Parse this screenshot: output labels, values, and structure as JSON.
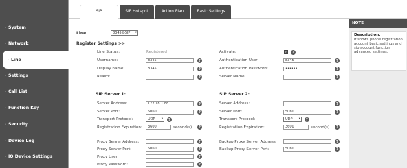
{
  "sidebar": {
    "items": [
      {
        "label": "System",
        "active": false
      },
      {
        "label": "Network",
        "active": false
      },
      {
        "label": "Line",
        "active": true
      },
      {
        "label": "Settings",
        "active": false
      },
      {
        "label": "Call List",
        "active": false
      },
      {
        "label": "Function Key",
        "active": false
      },
      {
        "label": "Security",
        "active": false
      },
      {
        "label": "Device Log",
        "active": false
      },
      {
        "label": "IO Device Settings",
        "active": false
      }
    ],
    "chevron": "›"
  },
  "tabs": [
    "SIP",
    "SIP Hotspot",
    "Action Plan",
    "Basic Settings"
  ],
  "line": {
    "label": "Line",
    "value": "8345@SIP"
  },
  "register": {
    "heading": "Register Settings >>",
    "line_status_label": "Line Status:",
    "line_status_value": "Registered",
    "activate_label": "Activate:",
    "activate_checked": true,
    "username_label": "Username:",
    "username_value": "8345",
    "auth_user_label": "Authentication User:",
    "auth_user_value": "8345",
    "display_name_label": "Display name:",
    "display_name_value": "8345",
    "auth_password_label": "Authentication Password:",
    "auth_password_value": "••••••",
    "realm_label": "Realm:",
    "realm_value": "",
    "server_name_label": "Server Name:",
    "server_name_value": ""
  },
  "sip1": {
    "heading": "SIP Server 1:",
    "server_address_label": "Server Address:",
    "server_address_value": "172.18.1.88",
    "server_port_label": "Server Port:",
    "server_port_value": "5060",
    "transport_label": "Transport Protocol:",
    "transport_value": "UDP",
    "expiration_label": "Registration Expiration:",
    "expiration_value": "3600",
    "expiration_unit": "second(s)"
  },
  "sip2": {
    "heading": "SIP Server 2:",
    "server_address_label": "Server Address:",
    "server_address_value": "",
    "server_port_label": "Server Port:",
    "server_port_value": "5060",
    "transport_label": "Transport Protocol:",
    "transport_value": "UDP",
    "expiration_label": "Registration Expiration:",
    "expiration_value": "3600",
    "expiration_unit": "second(s)"
  },
  "proxy": {
    "proxy_address_label": "Proxy Server Address:",
    "proxy_address_value": "",
    "proxy_port_label": "Proxy Server Port:",
    "proxy_port_value": "5060",
    "proxy_user_label": "Proxy User:",
    "proxy_user_value": "",
    "proxy_password_label": "Proxy Password:",
    "proxy_password_value": "",
    "backup_address_label": "Backup Proxy Server Address:",
    "backup_address_value": "",
    "backup_port_label": "Backup Proxy Server Port:",
    "backup_port_value": "5060"
  },
  "help_glyph": "?",
  "caret_glyph": "▾",
  "check_glyph": "✓",
  "note": {
    "heading": "NOTE",
    "title": "Description:",
    "text": "It shows phone registration account basic settings and sip account function advanced settings."
  }
}
